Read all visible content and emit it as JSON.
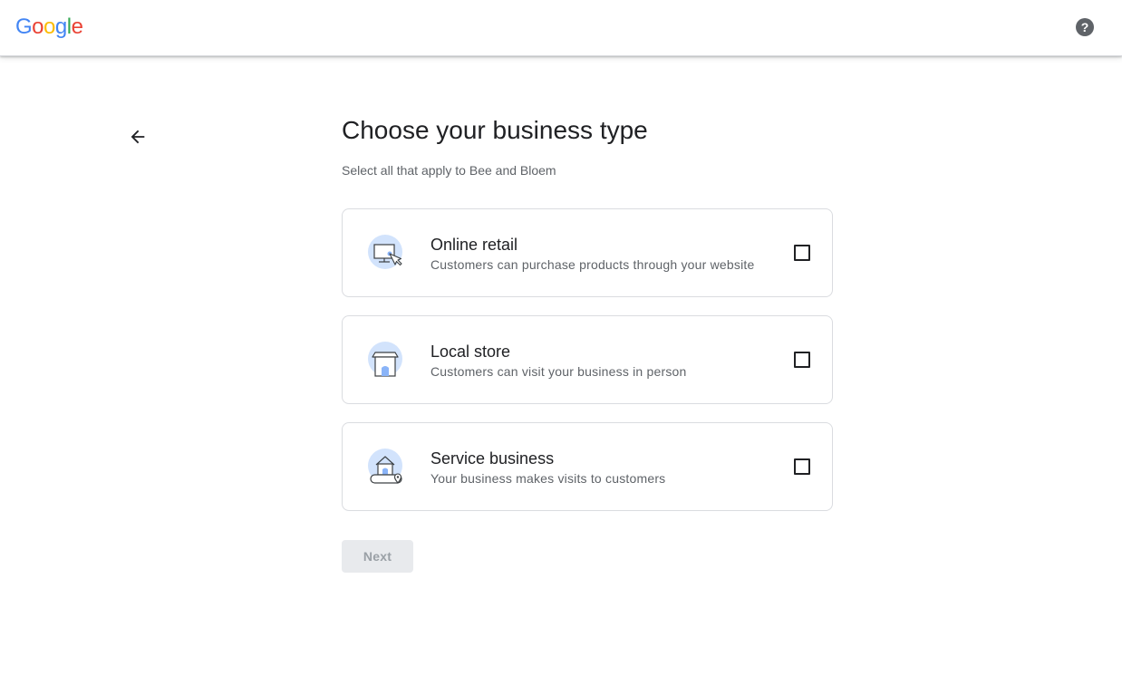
{
  "header": {
    "logo": [
      {
        "ch": "G",
        "color": "#4285F4"
      },
      {
        "ch": "o",
        "color": "#EA4335"
      },
      {
        "ch": "o",
        "color": "#FBBC05"
      },
      {
        "ch": "g",
        "color": "#4285F4"
      },
      {
        "ch": "l",
        "color": "#34A853"
      },
      {
        "ch": "e",
        "color": "#EA4335"
      }
    ],
    "help_icon": "?"
  },
  "page": {
    "back_icon": "arrow-back-icon",
    "title": "Choose your business type",
    "subtitle": "Select all that apply to Bee and Bloem"
  },
  "options": [
    {
      "icon": "online-retail-icon",
      "title": "Online retail",
      "description": "Customers can purchase products through your website",
      "checked": false
    },
    {
      "icon": "local-store-icon",
      "title": "Local store",
      "description": "Customers can visit your business in person",
      "checked": false
    },
    {
      "icon": "service-business-icon",
      "title": "Service business",
      "description": "Your business makes visits to customers",
      "checked": false
    }
  ],
  "actions": {
    "next_label": "Next",
    "next_enabled": false
  },
  "colors": {
    "illustration_circle": "#d2e3fc",
    "illustration_accent": "#8ab4f8",
    "disabled_button_bg": "#e8eaed",
    "disabled_button_text": "#9aa0a6"
  }
}
